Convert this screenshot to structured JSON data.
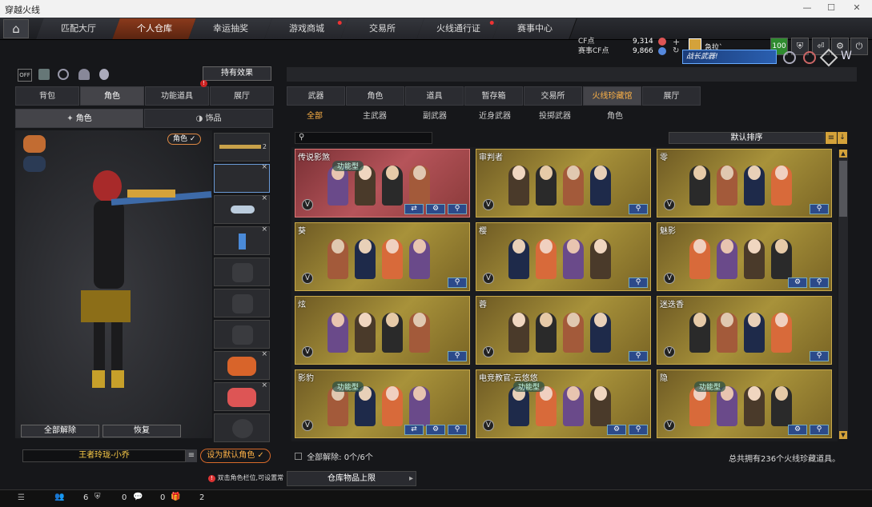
{
  "window": {
    "title": "穿越火线"
  },
  "nav": {
    "tabs": [
      "匹配大厅",
      "个人仓库",
      "幸运抽奖",
      "游戏商城",
      "交易所",
      "火线通行证",
      "赛事中心"
    ],
    "active": 1
  },
  "currency": {
    "cf_label": "CF点",
    "cf_value": "9,314",
    "match_label": "赛事CF点",
    "match_value": "9,866"
  },
  "user": {
    "name": "急拉`",
    "level": "100"
  },
  "banner": {
    "text": "战长武器!"
  },
  "left": {
    "effect_button": "持有效果",
    "tabs": [
      "背包",
      "角色",
      "功能道具",
      "展厅"
    ],
    "subtabs": [
      "角色",
      "饰品"
    ],
    "role_badge": "角色 ✓",
    "unequip_all": "全部解除",
    "restore": "恢复",
    "char_name": "王者玲珑-小乔",
    "set_default": "设为默认角色 ✓",
    "gun_slot_num": "2"
  },
  "right": {
    "tabs": [
      "武器",
      "角色",
      "道具",
      "暂存箱",
      "交易所",
      "火线珍藏馆",
      "展厅"
    ],
    "subtabs": [
      "全部",
      "主武器",
      "副武器",
      "近身武器",
      "投掷武器",
      "角色"
    ],
    "sort": "默认排序",
    "unequip_label": "全部解除:",
    "unequip_count": "0个/6个",
    "total": "总共拥有236个火线珍藏道具。",
    "cards": [
      {
        "title": "传说影煞",
        "tag": "功能型",
        "red": true,
        "btns": 3
      },
      {
        "title": "审判者",
        "tag": "",
        "btns": 1
      },
      {
        "title": "零",
        "tag": "",
        "btns": 1
      },
      {
        "title": "葵",
        "tag": "",
        "btns": 1
      },
      {
        "title": "樱",
        "tag": "",
        "btns": 1
      },
      {
        "title": "魅影",
        "tag": "",
        "btns": 2
      },
      {
        "title": "炫",
        "tag": "",
        "btns": 1
      },
      {
        "title": "蓉",
        "tag": "",
        "btns": 1
      },
      {
        "title": "迷迭香",
        "tag": "",
        "btns": 1
      },
      {
        "title": "影豹",
        "tag": "功能型",
        "btns": 3
      },
      {
        "title": "电竞教官-云悠悠",
        "tag": "功能型",
        "btns": 2
      },
      {
        "title": "隐",
        "tag": "功能型",
        "btns": 2
      }
    ]
  },
  "status": {
    "tip": "双击角色栏位,可设置常",
    "warehouse": "仓库物品上限",
    "c1": "6",
    "c2": "0",
    "c3": "0",
    "c4": "2"
  }
}
